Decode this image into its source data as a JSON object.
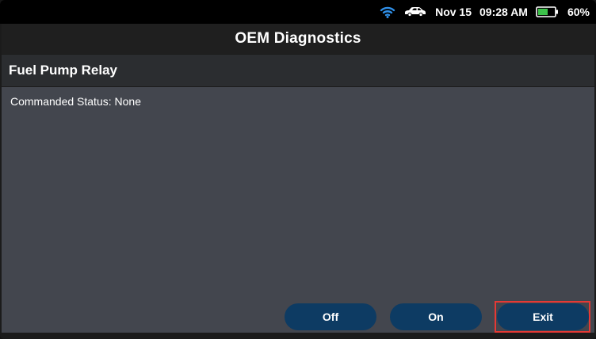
{
  "status_bar": {
    "icons": [
      "wifi-icon",
      "car-icon",
      "battery-icon"
    ],
    "date": "Nov 15",
    "time": "09:28 AM",
    "battery_percent": "60%",
    "battery_level": 0.6,
    "wifi_color": "#2f8fe8",
    "battery_color": "#3cc24a"
  },
  "header": {
    "title": "OEM Diagnostics"
  },
  "section": {
    "title": "Fuel Pump Relay"
  },
  "content": {
    "commanded_status": "Commanded Status: None"
  },
  "buttons": {
    "off_label": "Off",
    "on_label": "On",
    "exit_label": "Exit"
  },
  "colors": {
    "button_bg": "#0d3b63",
    "panel_bg": "#43464e",
    "highlight": "#e53935"
  }
}
